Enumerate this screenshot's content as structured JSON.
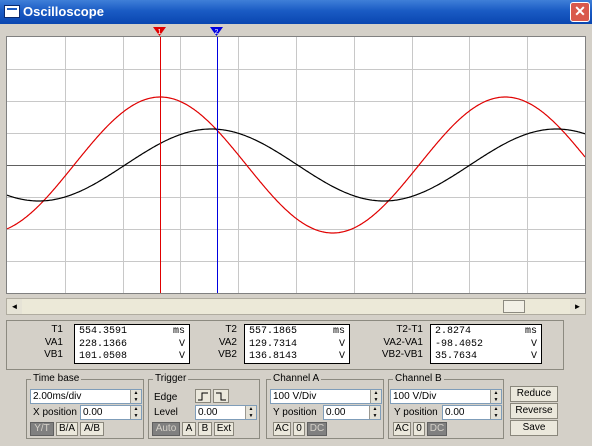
{
  "window": {
    "title": "Oscilloscope",
    "close_glyph": "✕"
  },
  "cursors": {
    "t1_label": "1",
    "t2_label": "2",
    "t1_color": "#e00000",
    "t2_color": "#0000e0"
  },
  "traces": {
    "channel_a_color": "#e00000",
    "channel_b_color": "#000000"
  },
  "readouts": {
    "left": {
      "labels": [
        "T1",
        "VA1",
        "VB1"
      ],
      "values": [
        {
          "num": "554.3591",
          "unit": "ms"
        },
        {
          "num": "228.1366",
          "unit": "V"
        },
        {
          "num": "101.0508",
          "unit": "V"
        }
      ]
    },
    "middle": {
      "labels": [
        "T2",
        "VA2",
        "VB2"
      ],
      "values": [
        {
          "num": "557.1865",
          "unit": "ms"
        },
        {
          "num": "129.7314",
          "unit": "V"
        },
        {
          "num": "136.8143",
          "unit": "V"
        }
      ]
    },
    "right": {
      "labels": [
        "T2-T1",
        "VA2-VA1",
        "VB2-VB1"
      ],
      "values": [
        {
          "num": "2.8274",
          "unit": "ms"
        },
        {
          "num": "-98.4052",
          "unit": "V"
        },
        {
          "num": "35.7634",
          "unit": "V"
        }
      ]
    }
  },
  "timebase": {
    "title": "Time base",
    "value": "2.00ms/div",
    "xpos_label": "X position",
    "xpos_value": "0.00",
    "modes": [
      "Y/T",
      "B/A",
      "A/B"
    ]
  },
  "trigger": {
    "title": "Trigger",
    "edge_label": "Edge",
    "level_label": "Level",
    "level_value": "0.00",
    "sources": [
      "Auto",
      "A",
      "B",
      "Ext"
    ]
  },
  "channel_a": {
    "title": "Channel A",
    "value": "100 V/Div",
    "ypos_label": "Y position",
    "ypos_value": "0.00",
    "coupling": [
      "AC",
      "0",
      "DC"
    ]
  },
  "channel_b": {
    "title": "Channel B",
    "value": "100 V/Div",
    "ypos_label": "Y position",
    "ypos_value": "0.00",
    "coupling": [
      "AC",
      "0",
      "DC"
    ]
  },
  "actions": {
    "reduce": "Reduce",
    "reverse": "Reverse",
    "save": "Save"
  },
  "scroll": {
    "left_glyph": "◄",
    "right_glyph": "►"
  }
}
